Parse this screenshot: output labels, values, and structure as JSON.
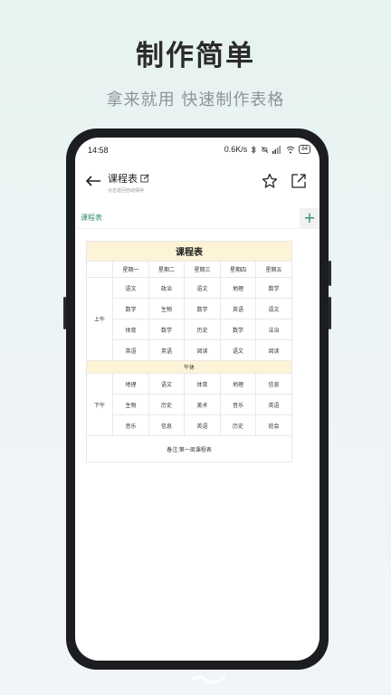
{
  "promo": {
    "headline": "制作简单",
    "subline": "拿来就用 快速制作表格"
  },
  "statusbar": {
    "time": "14:58",
    "speed": "0.6K/s",
    "battery": "84"
  },
  "appbar": {
    "title": "课程表",
    "subtitle": "点击返回自动保存",
    "icons": [
      "back-arrow-icon",
      "edit-icon",
      "star-icon",
      "share-icon"
    ]
  },
  "tabs": {
    "active": "课程表",
    "add_icon": "plus-icon"
  },
  "schedule": {
    "title": "课程表",
    "headers": [
      "",
      "星期一",
      "星期二",
      "星期三",
      "星期四",
      "星期五"
    ],
    "morning_label": "上午",
    "morning_rows": [
      [
        "语文",
        "政治",
        "语文",
        "地理",
        "数学"
      ],
      [
        "数学",
        "生物",
        "数学",
        "英语",
        "语文"
      ],
      [
        "体育",
        "数学",
        "历史",
        "数学",
        "法治"
      ],
      [
        "英语",
        "英语",
        "阅读",
        "语文",
        "阅读"
      ]
    ],
    "noon_label": "午休",
    "afternoon_label": "下午",
    "afternoon_rows": [
      [
        "地理",
        "语文",
        "体育",
        "地理",
        "信息"
      ],
      [
        "生物",
        "历史",
        "美术",
        "音乐",
        "英语"
      ],
      [
        "音乐",
        "信息",
        "英语",
        "历史",
        "班会"
      ]
    ],
    "note": "备注:第一周课程表"
  }
}
